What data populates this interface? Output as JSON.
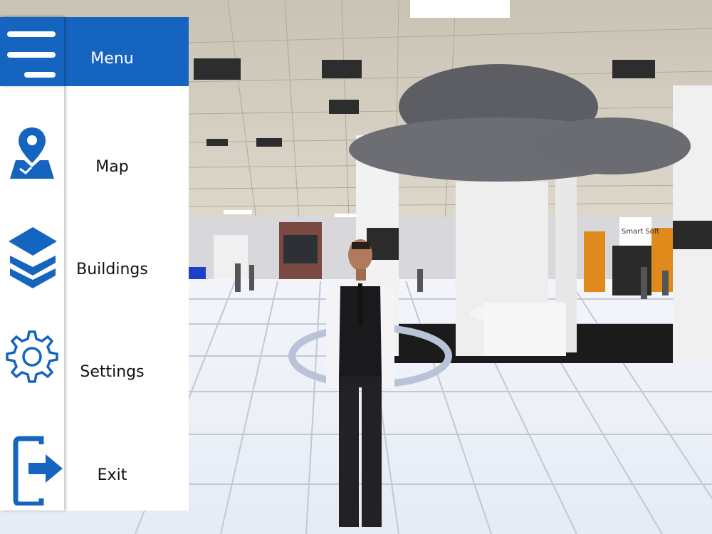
{
  "menu": {
    "title": "Menu",
    "items": [
      {
        "label": "Map",
        "icon": "map-pin-icon"
      },
      {
        "label": "Buildings",
        "icon": "layers-icon"
      },
      {
        "label": "Settings",
        "icon": "gear-icon"
      },
      {
        "label": "Exit",
        "icon": "exit-icon"
      }
    ]
  },
  "booth": {
    "sign_text": "Smart Soft"
  },
  "colors": {
    "accent": "#1565c0",
    "panel": "#ffffff",
    "floor": "#eef2f8"
  }
}
